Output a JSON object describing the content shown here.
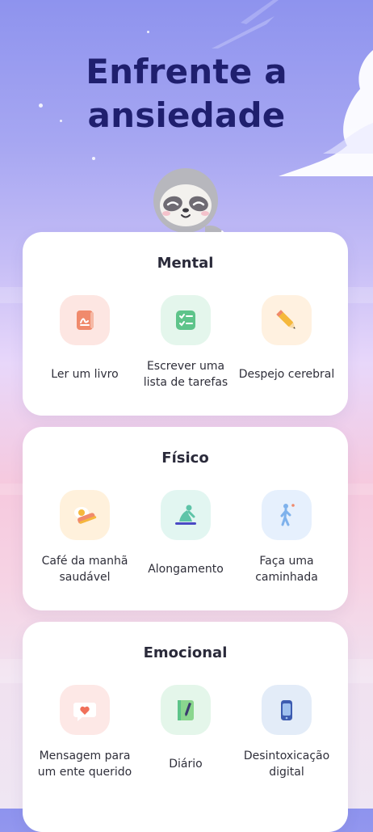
{
  "header": {
    "title_line1": "Enfrente a",
    "title_line2": "ansiedade"
  },
  "sections": [
    {
      "title": "Mental",
      "items": [
        {
          "label": "Ler um livro",
          "icon": "book-icon",
          "bg": "#fde6e2"
        },
        {
          "label": "Escrever uma lista de tarefas",
          "icon": "checklist-icon",
          "bg": "#e4f6ec"
        },
        {
          "label": "Despejo cerebral",
          "icon": "pencil-icon",
          "bg": "#fff1e0"
        }
      ]
    },
    {
      "title": "Físico",
      "items": [
        {
          "label": "Café da manhã saudável",
          "icon": "breakfast-icon",
          "bg": "#fff1dc"
        },
        {
          "label": "Alongamento",
          "icon": "stretching-icon",
          "bg": "#e2f6f1"
        },
        {
          "label": "Faça uma caminhada",
          "icon": "walking-icon",
          "bg": "#e6f0fd"
        }
      ]
    },
    {
      "title": "Emocional",
      "items": [
        {
          "label": "Mensagem para um ente querido",
          "icon": "heart-message-icon",
          "bg": "#fde8e6"
        },
        {
          "label": "Diário",
          "icon": "journal-icon",
          "bg": "#e4f6ea"
        },
        {
          "label": "Desintoxicação digital",
          "icon": "phone-icon",
          "bg": "#e3ecf8"
        }
      ]
    }
  ],
  "colors": {
    "title": "#1f1f6e",
    "card": "#ffffff"
  }
}
